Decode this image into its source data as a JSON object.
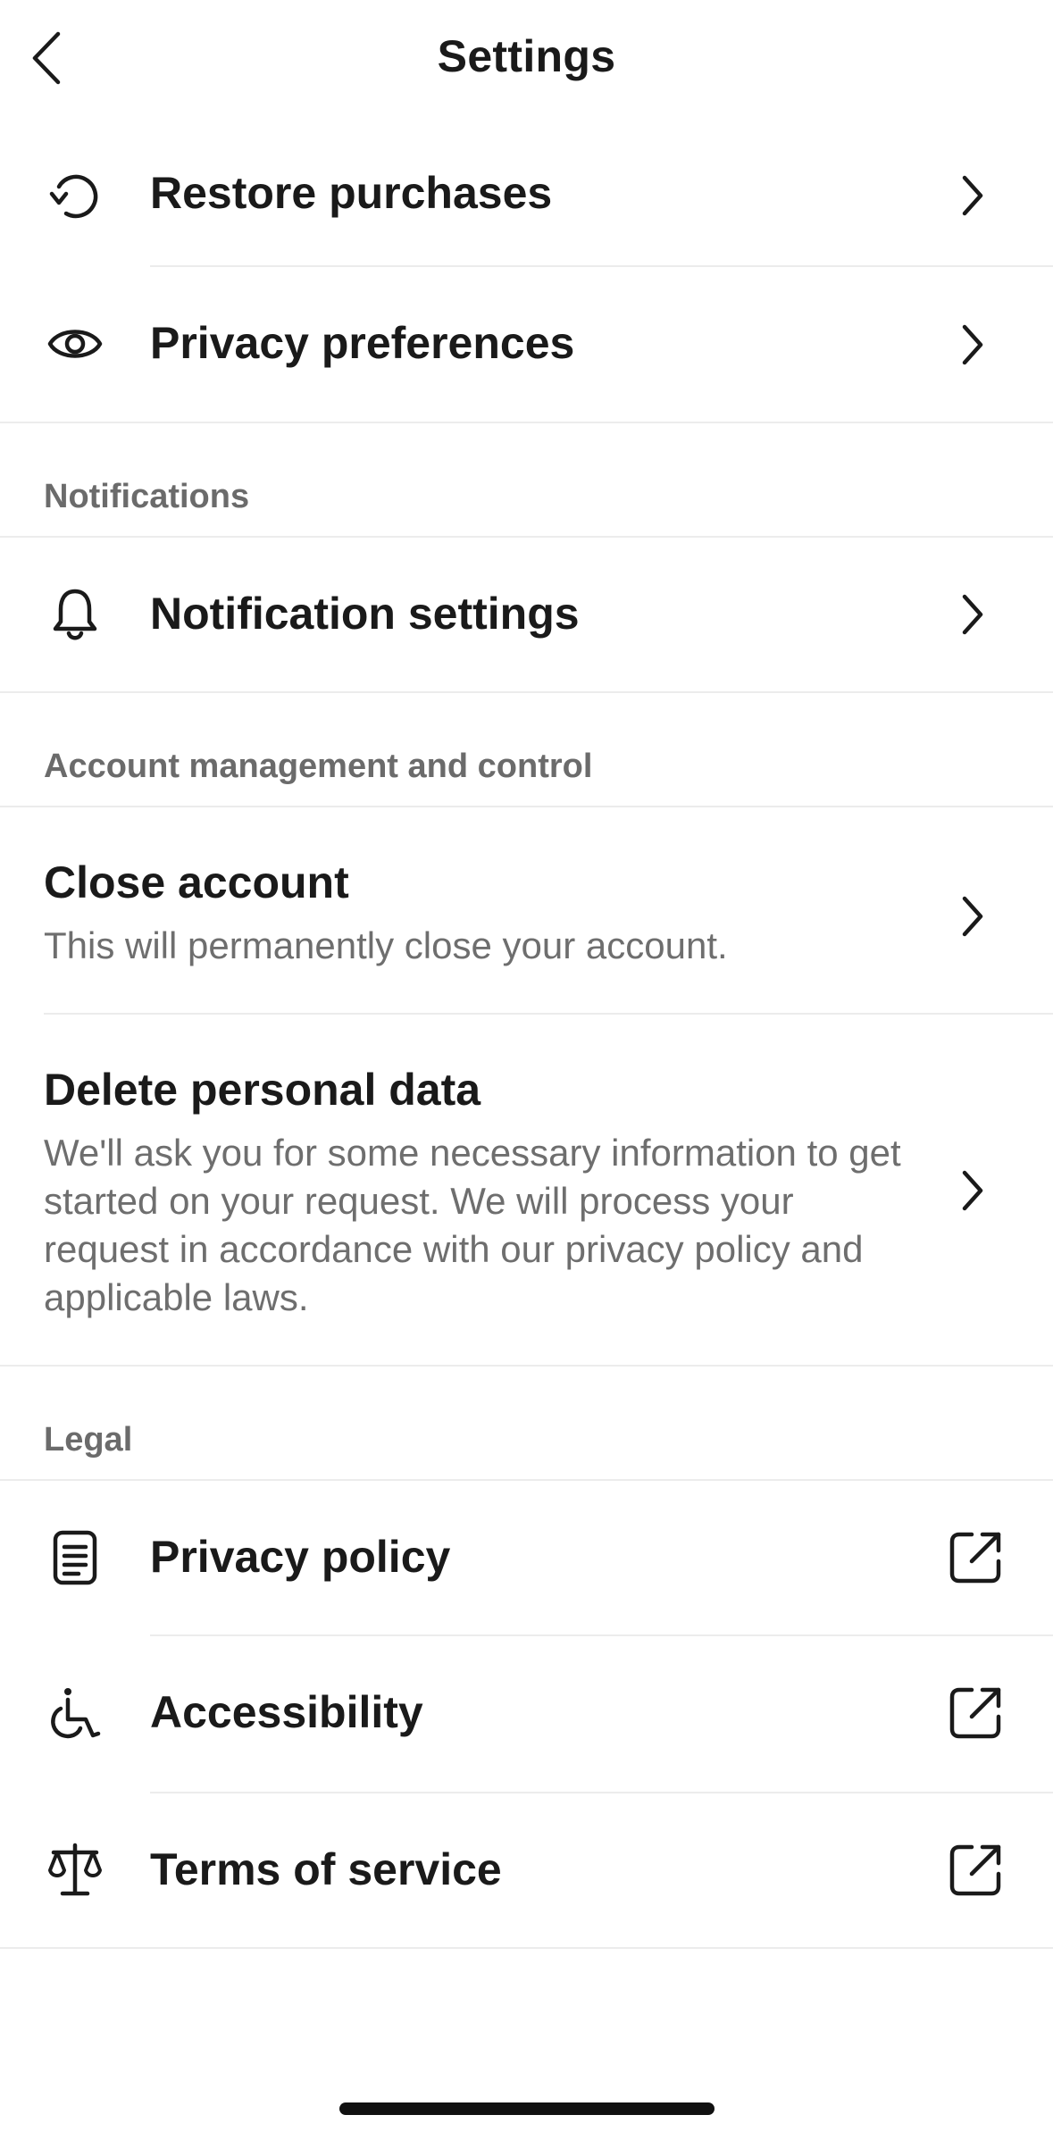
{
  "header": {
    "title": "Settings",
    "back_icon": "chevron-left-icon"
  },
  "account_rows": [
    {
      "label": "Restore purchases",
      "icon": "restore-icon",
      "action": "chevron-right-icon"
    },
    {
      "label": "Privacy preferences",
      "icon": "eye-icon",
      "action": "chevron-right-icon"
    }
  ],
  "notifications": {
    "section_title": "Notifications",
    "rows": [
      {
        "label": "Notification settings",
        "icon": "bell-icon",
        "action": "chevron-right-icon"
      }
    ]
  },
  "account_management": {
    "section_title": "Account management and control",
    "close_account": {
      "label": "Close account",
      "description": "This will permanently close your account."
    },
    "delete_data": {
      "label": "Delete personal data",
      "description": "We'll ask you for some necessary information to get started on your request. We will process your request in accordance with our privacy policy and applicable laws."
    }
  },
  "legal": {
    "section_title": "Legal",
    "rows": [
      {
        "label": "Privacy policy",
        "icon": "document-icon",
        "action": "external-link-icon"
      },
      {
        "label": "Accessibility",
        "icon": "wheelchair-icon",
        "action": "external-link-icon"
      },
      {
        "label": "Terms of service",
        "icon": "scales-icon",
        "action": "external-link-icon"
      }
    ]
  },
  "colors": {
    "background": "#ffffff",
    "text_primary": "#1a1a1a",
    "text_secondary": "#6e6e6e",
    "divider": "#ececec"
  }
}
